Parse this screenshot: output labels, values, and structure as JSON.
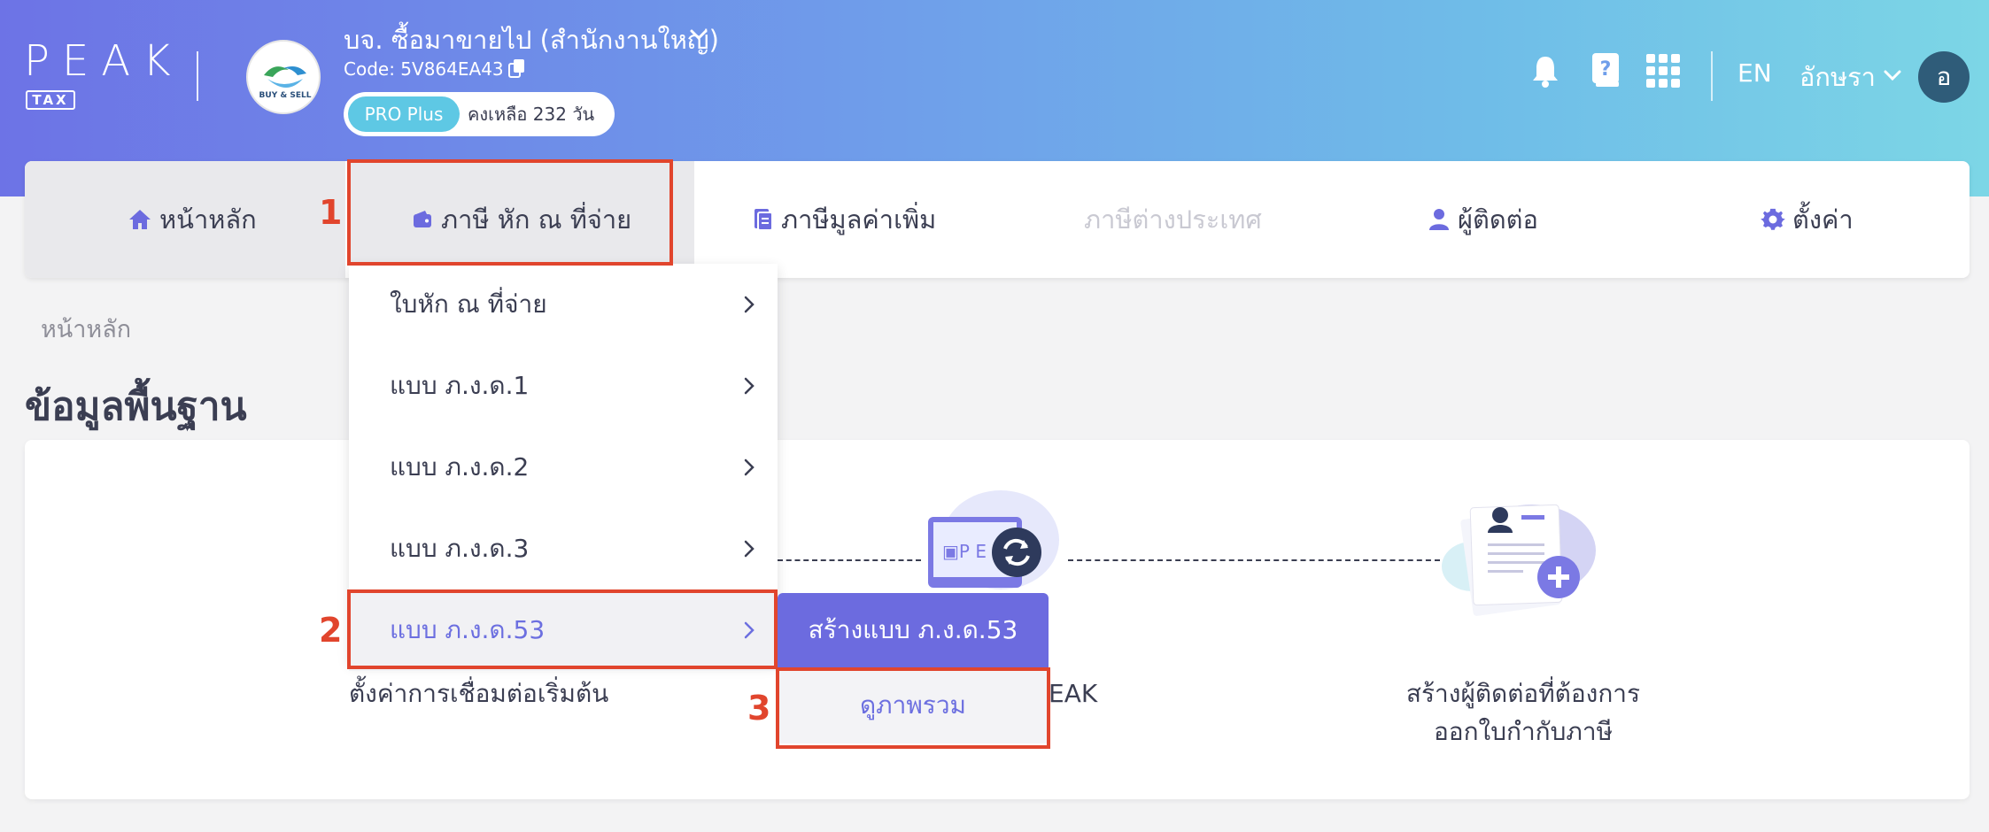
{
  "header": {
    "logo_text": "PEAK",
    "logo_sub": "TAX",
    "company_name": "บจ. ซื้อมาขายไป (สำนักงานใหญ่)",
    "company_code": "Code: 5V864EA43",
    "company_logo_text": "BUY & SELL",
    "plan_badge": "PRO Plus",
    "plan_remaining": "คงเหลือ 232 วัน",
    "language": "EN",
    "user_name": "อักษรา",
    "avatar_initial": "อ"
  },
  "nav": {
    "items": [
      {
        "label": "หน้าหลัก"
      },
      {
        "label": "ภาษี หัก ณ ที่จ่าย"
      },
      {
        "label": "ภาษีมูลค่าเพิ่ม"
      },
      {
        "label": "ภาษีต่างประเทศ"
      },
      {
        "label": "ผู้ติดต่อ"
      },
      {
        "label": "ตั้งค่า"
      }
    ]
  },
  "dropdown": {
    "items": [
      {
        "label": "ใบหัก ณ ที่จ่าย"
      },
      {
        "label": "แบบ ภ.ง.ด.1"
      },
      {
        "label": "แบบ ภ.ง.ด.2"
      },
      {
        "label": "แบบ ภ.ง.ด.3"
      },
      {
        "label": "แบบ ภ.ง.ด.53"
      }
    ]
  },
  "submenu": {
    "create_label": "สร้างแบบ ภ.ง.ด.53",
    "overview_label": "ดูภาพรวม"
  },
  "callouts": [
    "1",
    "2",
    "3"
  ],
  "main": {
    "breadcrumb": "หน้าหลัก",
    "title": "ข้อมูลพื้นฐาน",
    "steps": [
      {
        "text": "ตั้งค่าการเชื่อมต่อเริ่มต้น"
      },
      {
        "text": "EAK"
      },
      {
        "text_line1": "สร้างผู้ติดต่อที่ต้องการ",
        "text_line2": "ออกใบกำกับภาษี"
      }
    ]
  },
  "colors": {
    "accent": "#6c6bdf",
    "callout": "#e1452d",
    "header_start": "#6d73e6",
    "header_end": "#7cd6e6"
  }
}
